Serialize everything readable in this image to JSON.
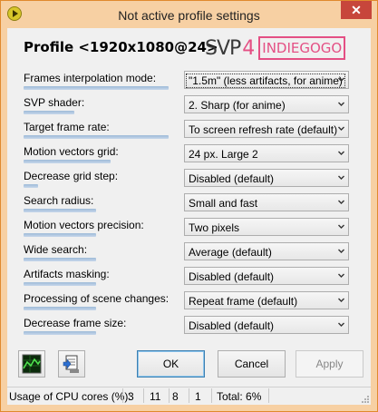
{
  "window": {
    "title": "Not active profile settings",
    "close_symbol": "✕"
  },
  "profile": {
    "title": "Profile <1920x1080@24>"
  },
  "logo": {
    "part1": "SVP",
    "part2": "4",
    "part3": "INDIEGOGO"
  },
  "settings": [
    {
      "label": "Frames interpolation mode:",
      "value": "\"1.5m\" (less artifacts, for anime)",
      "fill": 1.0
    },
    {
      "label": "SVP shader:",
      "value": "2. Sharp (for anime)",
      "fill": 0.35
    },
    {
      "label": "Target frame rate:",
      "value": "To screen refresh rate (default)",
      "fill": 1.0
    },
    {
      "label": "Motion vectors grid:",
      "value": "24 px. Large 2",
      "fill": 0.6
    },
    {
      "label": "Decrease grid step:",
      "value": "Disabled (default)",
      "fill": 0.1
    },
    {
      "label": "Search radius:",
      "value": "Small and fast",
      "fill": 0.5
    },
    {
      "label": "Motion vectors precision:",
      "value": "Two pixels",
      "fill": 0.5
    },
    {
      "label": "Wide search:",
      "value": "Average (default)",
      "fill": 0.5
    },
    {
      "label": "Artifacts masking:",
      "value": "Disabled (default)",
      "fill": 0.5
    },
    {
      "label": "Processing of scene changes:",
      "value": "Repeat frame (default)",
      "fill": 0.5
    },
    {
      "label": "Decrease frame size:",
      "value": "Disabled (default)",
      "fill": 0.5
    }
  ],
  "buttons": {
    "ok": "OK",
    "cancel": "Cancel",
    "apply": "Apply"
  },
  "status": {
    "label": "Usage of CPU cores (%):",
    "cores": [
      "3",
      "11",
      "8",
      "1"
    ],
    "total": "Total: 6%"
  },
  "colors": {
    "frame": "#f7d0a3",
    "close": "#c7463b",
    "accent": "#e44f84"
  }
}
